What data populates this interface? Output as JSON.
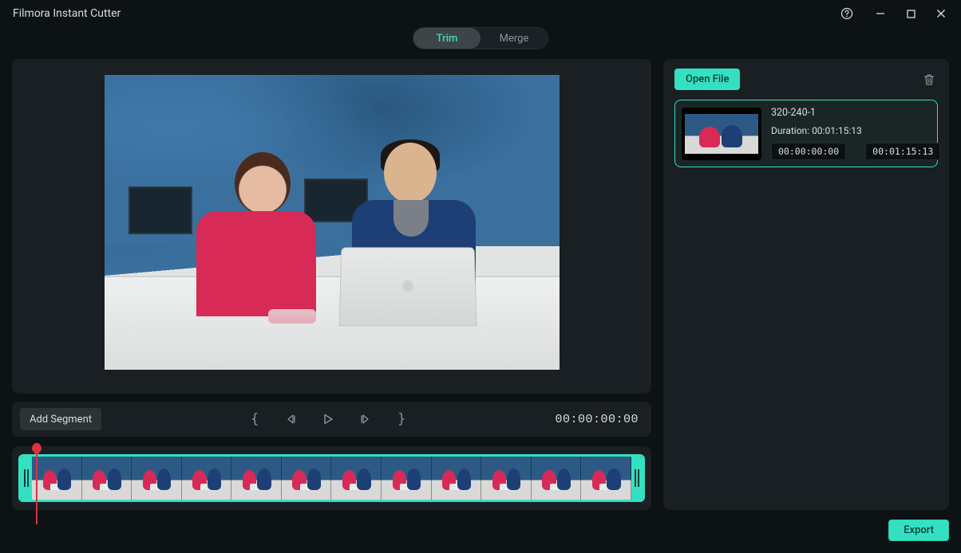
{
  "app_title": "Filmora Instant Cutter",
  "tabs": {
    "trim": "Trim",
    "merge": "Merge"
  },
  "controls": {
    "add_segment": "Add Segment",
    "current_timecode": "00:00:00:00"
  },
  "sidebar": {
    "open_file": "Open File",
    "clip": {
      "name": "320-240-1",
      "duration_label": "Duration:",
      "duration_value": "00:01:15:13",
      "in_tc": "00:00:00:00",
      "out_tc": "00:01:15:13"
    }
  },
  "footer": {
    "export": "Export"
  },
  "colors": {
    "accent": "#34e0c2",
    "red": "#d9333f",
    "bg_main": "#0d1214"
  }
}
